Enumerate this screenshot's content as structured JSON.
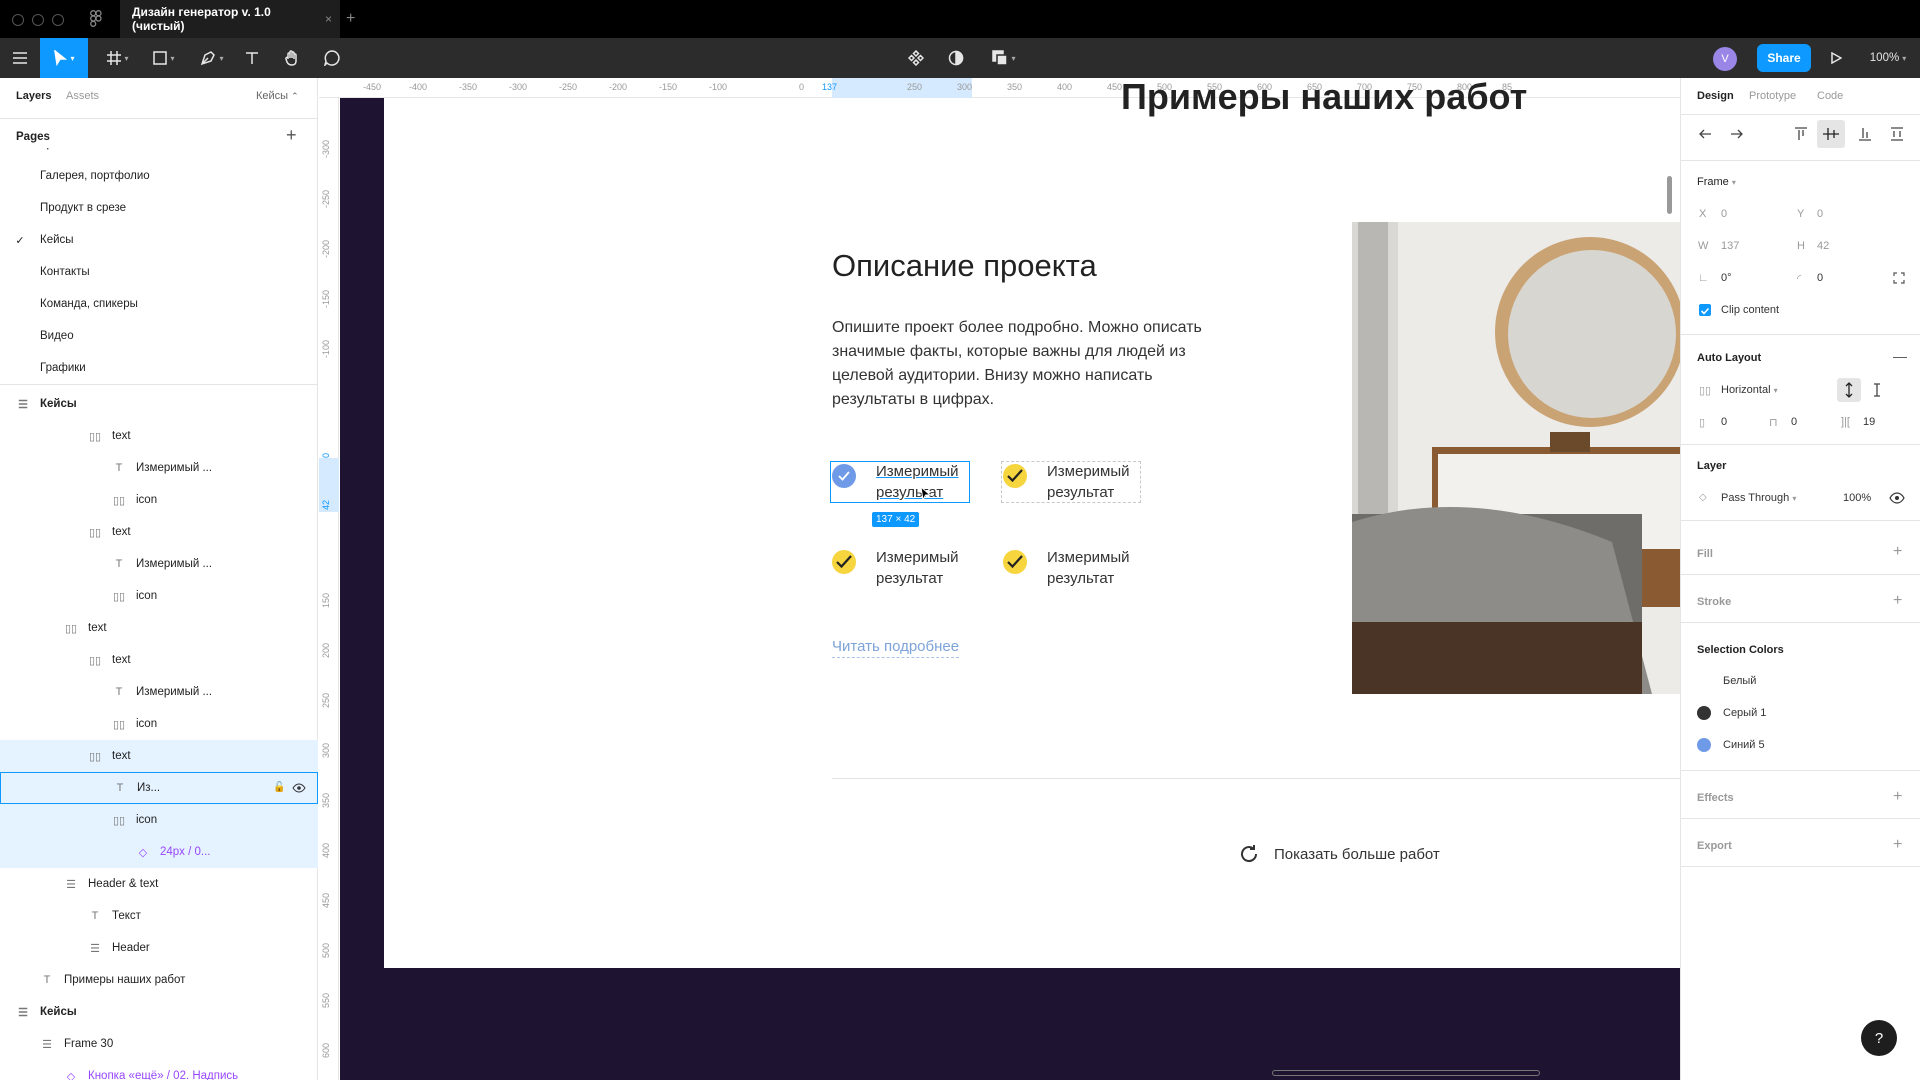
{
  "titlebar": {
    "doc_tab": "Дизайн генератор v. 1.0 (чистый)",
    "tab_close": "×",
    "new_tab": "+"
  },
  "toolbar": {
    "share": "Share",
    "zoom": "100%",
    "avatar": "V"
  },
  "left_panel": {
    "tabs": {
      "layers": "Layers",
      "assets": "Assets",
      "page_select": "Кейсы"
    },
    "pages_title": "Pages",
    "pages_add": "+",
    "pages": [
      {
        "label": "Цены"
      },
      {
        "label": "Галерея, портфолио"
      },
      {
        "label": "Продукт в срезе"
      },
      {
        "label": "Кейсы",
        "selected": true
      },
      {
        "label": "Контакты"
      },
      {
        "label": "Команда, спикеры"
      },
      {
        "label": "Видео"
      },
      {
        "label": "Графики"
      }
    ],
    "layers": [
      {
        "label": "Кейсы",
        "icon": "autolayout",
        "indent": 0,
        "bold": true
      },
      {
        "label": "text",
        "icon": "frame",
        "indent": 3
      },
      {
        "label": "Измеримый ...",
        "icon": "text",
        "indent": 4
      },
      {
        "label": "icon",
        "icon": "frame",
        "indent": 4
      },
      {
        "label": "text",
        "icon": "frame",
        "indent": 3
      },
      {
        "label": "Измеримый ...",
        "icon": "text",
        "indent": 4
      },
      {
        "label": "icon",
        "icon": "frame",
        "indent": 4
      },
      {
        "label": "text",
        "icon": "frame",
        "indent": 2
      },
      {
        "label": "text",
        "icon": "frame",
        "indent": 3
      },
      {
        "label": "Измеримый ...",
        "icon": "text",
        "indent": 4
      },
      {
        "label": "icon",
        "icon": "frame",
        "indent": 4
      },
      {
        "label": "text",
        "icon": "frame",
        "indent": 3,
        "state": "parent"
      },
      {
        "label": "Из...",
        "icon": "text",
        "indent": 4,
        "state": "selected"
      },
      {
        "label": "icon",
        "icon": "frame",
        "indent": 4,
        "state": "parent"
      },
      {
        "label": "24px / 0...",
        "icon": "component",
        "indent": 5,
        "state": "parent",
        "component": true
      },
      {
        "label": "Header & text",
        "icon": "autolayout",
        "indent": 2
      },
      {
        "label": "Текст",
        "icon": "text",
        "indent": 3
      },
      {
        "label": "Header",
        "icon": "autolayout",
        "indent": 3
      },
      {
        "label": "Примеры наших работ",
        "icon": "text",
        "indent": 1
      },
      {
        "label": "Кейсы",
        "icon": "autolayout",
        "indent": 0,
        "bold": true
      },
      {
        "label": "Frame 30",
        "icon": "autolayout",
        "indent": 1
      },
      {
        "label": "Кнопка «ещё» / 02. Надпись",
        "icon": "component",
        "indent": 2,
        "component": true
      }
    ]
  },
  "rulers": {
    "top": [
      "-450",
      "-400",
      "-350",
      "-300",
      "-250",
      "-200",
      "-150",
      "-100",
      "0",
      "137",
      "250",
      "300",
      "350",
      "400",
      "450",
      "500",
      "550",
      "600",
      "650",
      "700",
      "750",
      "800",
      "85"
    ],
    "left": [
      "-300",
      "-250",
      "-200",
      "-150",
      "-100",
      "0",
      "42",
      "150",
      "200",
      "250",
      "300",
      "350",
      "400",
      "450",
      "500",
      "550",
      "600"
    ]
  },
  "artboard": {
    "section_title": "Примеры наших работ",
    "project_title": "Описание проекта",
    "project_desc": "Опишите проект более подробно. Можно описать значимые факты, которые важны для людей из целевой аудитории. Внизу можно написать результаты в цифрах.",
    "results": [
      "Измеримый результат",
      "Измеримый результат",
      "Измеримый результат",
      "Измеримый результат"
    ],
    "selection_size": "137 × 42",
    "read_more": "Читать подробнее",
    "show_more": "Показать больше работ"
  },
  "right_panel": {
    "tabs": {
      "design": "Design",
      "prototype": "Prototype",
      "code": "Code"
    },
    "frame_label": "Frame",
    "x_label": "X",
    "x": "0",
    "y_label": "Y",
    "y": "0",
    "w_label": "W",
    "w": "137",
    "h_label": "H",
    "h": "42",
    "rotation": "0°",
    "radius": "0",
    "clip_content": "Clip content",
    "auto_layout": "Auto Layout",
    "direction": "Horizontal",
    "pad_h": "0",
    "pad_v": "0",
    "gap": "19",
    "layer": "Layer",
    "blend": "Pass Through",
    "opacity": "100%",
    "fill": "Fill",
    "stroke": "Stroke",
    "selection_colors": "Selection Colors",
    "colors": [
      {
        "name": "Белый",
        "hex": "#ffffff"
      },
      {
        "name": "Серый 1",
        "hex": "#333333"
      },
      {
        "name": "Синий 5",
        "hex": "#6f9ae8"
      }
    ],
    "effects": "Effects",
    "export": "Export",
    "help": "?"
  },
  "colors": {
    "accent": "#0d99ff",
    "canvas": "#1e1432",
    "check": "#f6d53f",
    "link": "#7ea3d8"
  }
}
